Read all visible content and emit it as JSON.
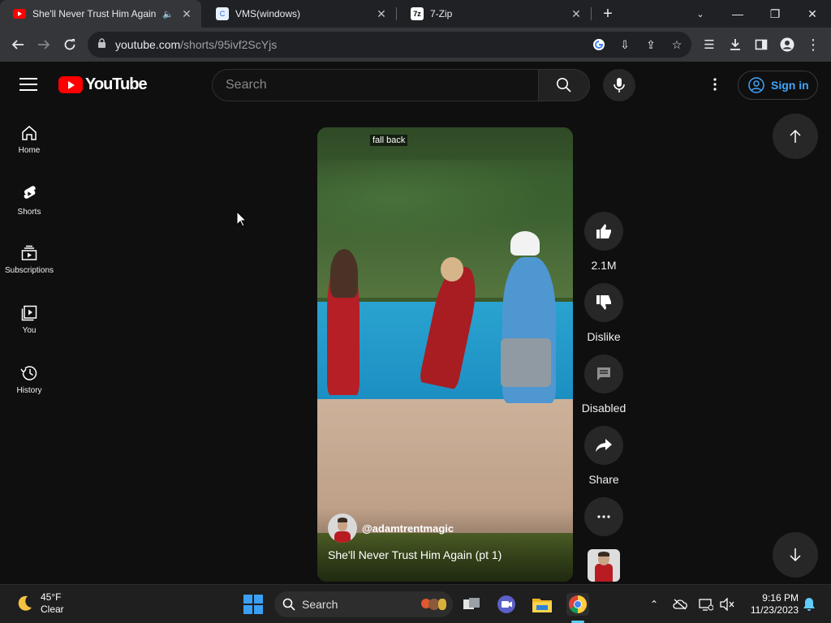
{
  "browser": {
    "tabs": [
      {
        "title": "She'll Never Trust Him Again (pt 1)",
        "favicon": "youtube-favicon"
      },
      {
        "title": "VMS(windows)",
        "favicon": "vms-favicon"
      },
      {
        "title": "7-Zip",
        "favicon": "7zip-favicon"
      }
    ],
    "url_host": "youtube.com",
    "url_path": "/shorts/95ivf2ScYjs"
  },
  "header": {
    "logo_text": "YouTube",
    "search_placeholder": "Search",
    "signin_label": "Sign in"
  },
  "sidebar": {
    "items": [
      {
        "label": "Home",
        "icon": "home-icon"
      },
      {
        "label": "Shorts",
        "icon": "shorts-icon"
      },
      {
        "label": "Subscriptions",
        "icon": "subscriptions-icon"
      },
      {
        "label": "You",
        "icon": "you-icon"
      },
      {
        "label": "History",
        "icon": "history-icon"
      }
    ]
  },
  "video": {
    "caption": "fall back",
    "channel": "@adamtrentmagic",
    "title": "She'll Never Trust Him Again (pt 1)"
  },
  "actions": {
    "like_count": "2.1M",
    "dislike_label": "Dislike",
    "comments_label": "Disabled",
    "share_label": "Share"
  },
  "taskbar": {
    "weather_temp": "45°F",
    "weather_cond": "Clear",
    "search_label": "Search",
    "time": "9:16 PM",
    "date": "11/23/2023"
  },
  "colors": {
    "brand_red": "#ff0000",
    "link_blue": "#3ea6ff",
    "bg": "#0f0f0f"
  }
}
